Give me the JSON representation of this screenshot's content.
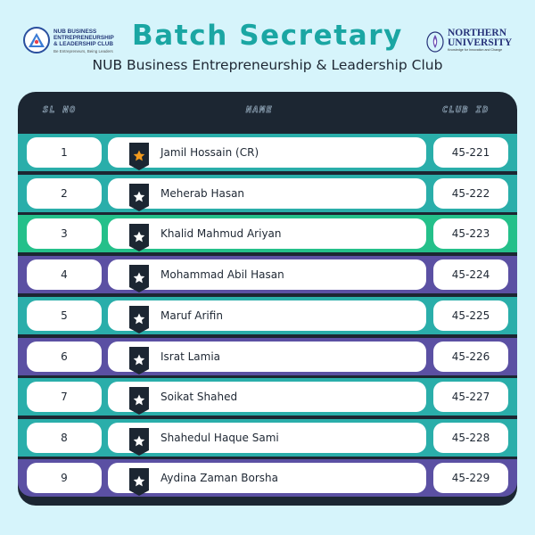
{
  "header": {
    "title": "Batch Secretary",
    "subtitle": "NUB Business Entrepreneurship & Leadership Club",
    "left_logo": {
      "line1": "NUB BUSINESS ENTREPRENEURSHIP",
      "line2": "& LEADERSHIP CLUB",
      "tagline": "Be Entrepreneurs, Being Leaders",
      "icon": "club-emblem-icon"
    },
    "right_logo": {
      "line1": "NORTHERN",
      "line2": "UNIVERSITY",
      "tagline": "Knowledge for Innovation and Change",
      "icon": "university-seal-icon"
    }
  },
  "table": {
    "headers": {
      "sl": "SL NO",
      "name": "NAME",
      "club_id": "CLUB ID"
    },
    "rows": [
      {
        "sl": "1",
        "name": "Jamil Hossain (CR)",
        "club_id": "45-221",
        "badge": "star-badge-orange"
      },
      {
        "sl": "2",
        "name": "Meherab Hasan",
        "club_id": "45-222",
        "badge": "star-badge-white"
      },
      {
        "sl": "3",
        "name": "Khalid Mahmud Ariyan",
        "club_id": "45-223",
        "badge": "star-badge-white"
      },
      {
        "sl": "4",
        "name": "Mohammad Abil Hasan",
        "club_id": "45-224",
        "badge": "star-badge-white"
      },
      {
        "sl": "5",
        "name": "Maruf Arifin",
        "club_id": "45-225",
        "badge": "star-badge-white"
      },
      {
        "sl": "6",
        "name": "Israt Lamia",
        "club_id": "45-226",
        "badge": "star-badge-white"
      },
      {
        "sl": "7",
        "name": "Soikat Shahed",
        "club_id": "45-227",
        "badge": "star-badge-white"
      },
      {
        "sl": "8",
        "name": "Shahedul Haque Sami",
        "club_id": "45-228",
        "badge": "star-badge-white"
      },
      {
        "sl": "9",
        "name": "Aydina Zaman Borsha",
        "club_id": "45-229",
        "badge": "star-badge-white"
      }
    ]
  },
  "colors": {
    "background": "#d6f4fb",
    "title": "#1aa6a3",
    "panel": "#1c2632",
    "row_teal": "#2aaeaa",
    "row_green": "#24c08a",
    "row_purple": "#5b50a3",
    "star_highlight": "#f39a1e"
  }
}
